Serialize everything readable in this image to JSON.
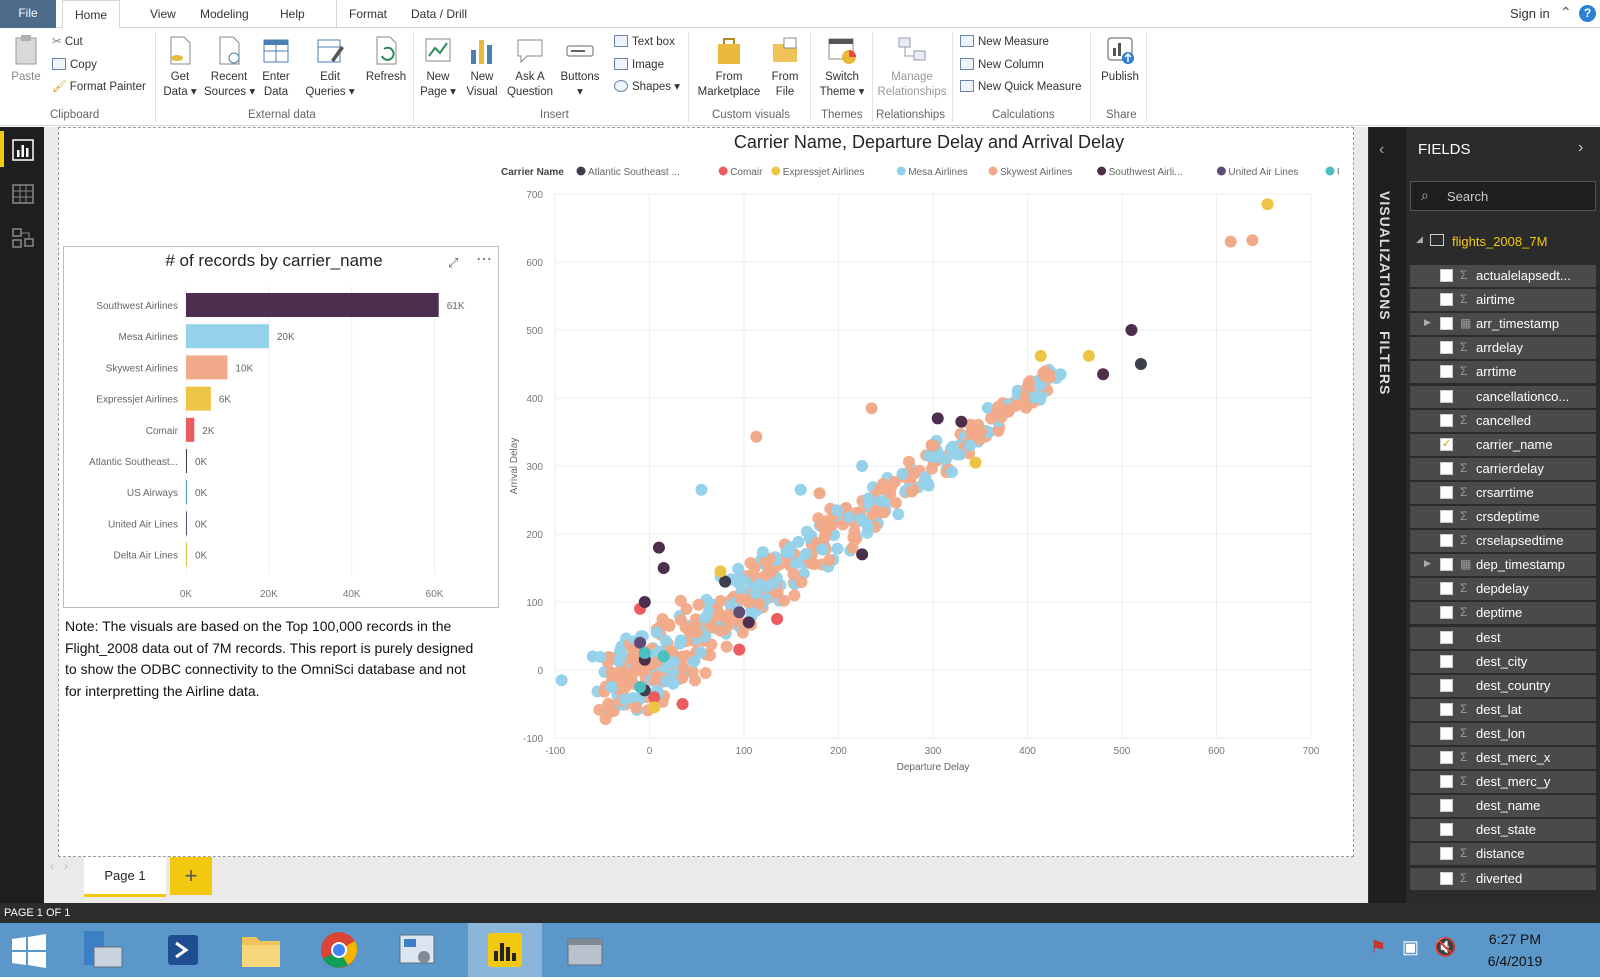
{
  "ribbon_tabs": [
    "File",
    "Home",
    "View",
    "Modeling",
    "Help",
    "Format",
    "Data / Drill"
  ],
  "sign_in": "Sign in",
  "ribbon": {
    "clipboard": {
      "paste": "Paste",
      "cut": "Cut",
      "copy": "Copy",
      "format_painter": "Format Painter",
      "group": "Clipboard"
    },
    "external": {
      "get_data": [
        "Get",
        "Data ▾"
      ],
      "recent": [
        "Recent",
        "Sources ▾"
      ],
      "enter": [
        "Enter",
        "Data"
      ],
      "edit": [
        "Edit",
        "Queries ▾"
      ],
      "refresh": "Refresh",
      "group": "External data"
    },
    "insert": {
      "new_page": [
        "New",
        "Page ▾"
      ],
      "new_visual": [
        "New",
        "Visual"
      ],
      "ask": [
        "Ask A",
        "Question"
      ],
      "buttons": [
        "Buttons",
        "▾"
      ],
      "text_box": "Text box",
      "image": "Image",
      "shapes": "Shapes ▾",
      "group": "Insert"
    },
    "custom": {
      "marketplace": [
        "From",
        "Marketplace"
      ],
      "file": [
        "From",
        "File"
      ],
      "group": "Custom visuals"
    },
    "themes": {
      "switch": [
        "Switch",
        "Theme ▾"
      ],
      "group": "Themes"
    },
    "relationships": {
      "manage": [
        "Manage",
        "Relationships"
      ],
      "group": "Relationships"
    },
    "calculations": {
      "new_measure": "New Measure",
      "new_column": "New Column",
      "new_quick": "New Quick Measure",
      "group": "Calculations"
    },
    "share": {
      "publish": "Publish",
      "group": "Share"
    }
  },
  "bar_chart": {
    "title": "# of records by carrier_name",
    "categories": [
      "Southwest Airlines",
      "Mesa Airlines",
      "Skywest Airlines",
      "Expressjet Airlines",
      "Comair",
      "Atlantic Southeast...",
      "US Airways",
      "United Air Lines",
      "Delta Air Lines"
    ],
    "values": [
      61000,
      20000,
      10000,
      6000,
      2000,
      0,
      0,
      0,
      0
    ],
    "value_labels": [
      "61K",
      "20K",
      "10K",
      "6K",
      "2K",
      "0K",
      "0K",
      "0K",
      "0K"
    ],
    "colors": [
      "#4b2f4c",
      "#94d1ea",
      "#f1aa89",
      "#eec445",
      "#ec5b5d",
      "#3d3f4d",
      "#4b9cc9",
      "#5f4c77",
      "#d6c94b"
    ],
    "x_ticks": [
      "0K",
      "20K",
      "40K",
      "60K"
    ]
  },
  "note": "Note: The visuals are based on the Top 100,000 records in the Flight_2008 data out of 7M records. This report is purely designed to show the ODBC connectivity to the OmniSci database and not for interpretting the Airline data.",
  "chart_data": {
    "type": "scatter",
    "title": "Carrier Name, Departure Delay and Arrival Delay",
    "xlabel": "Departure Delay",
    "ylabel": "Arrival Delay",
    "xlim": [
      -100,
      700
    ],
    "ylim": [
      -100,
      700
    ],
    "x_ticks": [
      -100,
      0,
      100,
      200,
      300,
      400,
      500,
      600,
      700
    ],
    "y_ticks": [
      -100,
      0,
      100,
      200,
      300,
      400,
      500,
      600,
      700
    ],
    "legend_title": "Carrier Name",
    "legend_position": "top",
    "series": [
      {
        "name": "Atlantic Southeast ...",
        "color": "#3d3f4d",
        "points": [
          [
            -5,
            -30
          ],
          [
            80,
            130
          ],
          [
            300,
            330
          ],
          [
            520,
            450
          ]
        ]
      },
      {
        "name": "Comair",
        "color": "#ec5b5d",
        "points": [
          [
            -10,
            90
          ],
          [
            5,
            -40
          ],
          [
            35,
            -50
          ],
          [
            135,
            75
          ],
          [
            95,
            30
          ]
        ]
      },
      {
        "name": "Expressjet Airlines",
        "color": "#eec445",
        "points": [
          [
            654,
            685
          ],
          [
            414,
            462
          ],
          [
            465,
            462
          ],
          [
            345,
            305
          ],
          [
            5,
            -55
          ],
          [
            75,
            145
          ]
        ]
      },
      {
        "name": "Mesa Airlines",
        "color": "#94d1ea",
        "points": [
          [
            -93,
            -15
          ],
          [
            -40,
            -25
          ],
          [
            55,
            265
          ],
          [
            160,
            265
          ],
          [
            435,
            435
          ],
          [
            408,
            400
          ],
          [
            225,
            300
          ],
          [
            -60,
            20
          ],
          [
            25,
            -20
          ]
        ]
      },
      {
        "name": "Skywest Airlines",
        "color": "#f1aa89",
        "points": [
          [
            615,
            630
          ],
          [
            638,
            632
          ],
          [
            113,
            343
          ],
          [
            235,
            385
          ],
          [
            180,
            260
          ],
          [
            300,
            330
          ],
          [
            380,
            380
          ]
        ]
      },
      {
        "name": "Southwest Airli...",
        "color": "#4b2f4c",
        "points": [
          [
            510,
            500
          ],
          [
            480,
            435
          ],
          [
            330,
            365
          ],
          [
            305,
            370
          ],
          [
            10,
            180
          ],
          [
            15,
            150
          ],
          [
            -5,
            100
          ],
          [
            -5,
            15
          ],
          [
            105,
            70
          ],
          [
            225,
            170
          ]
        ]
      },
      {
        "name": "United Air Lines",
        "color": "#5f4c77",
        "points": [
          [
            -10,
            40
          ],
          [
            95,
            85
          ]
        ]
      },
      {
        "name": "US Airways",
        "color": "#4bbfbf",
        "points": [
          [
            -10,
            -25
          ],
          [
            15,
            20
          ],
          [
            -5,
            25
          ]
        ]
      }
    ],
    "bulk_band": {
      "from": [
        -30,
        -40
      ],
      "to": [
        430,
        420
      ],
      "colors": [
        "#f1aa89",
        "#94d1ea"
      ]
    }
  },
  "page_tab": "Page 1",
  "add_page": "+",
  "side_labels": {
    "viz": "VISUALIZATIONS",
    "filters": "FILTERS"
  },
  "fields": {
    "header": "FIELDS",
    "search_placeholder": "Search",
    "table": "flights_2008_7M",
    "items": [
      {
        "name": "actualelapsedt...",
        "sigma": true,
        "checked": false
      },
      {
        "name": "airtime",
        "sigma": true,
        "checked": false
      },
      {
        "name": "arr_timestamp",
        "sigma": false,
        "checked": false,
        "table": true
      },
      {
        "name": "arrdelay",
        "sigma": true,
        "checked": false
      },
      {
        "name": "arrtime",
        "sigma": true,
        "checked": false
      },
      {
        "name": "cancellationco...",
        "sigma": false,
        "checked": false
      },
      {
        "name": "cancelled",
        "sigma": true,
        "checked": false
      },
      {
        "name": "carrier_name",
        "sigma": false,
        "checked": true
      },
      {
        "name": "carrierdelay",
        "sigma": true,
        "checked": false
      },
      {
        "name": "crsarrtime",
        "sigma": true,
        "checked": false
      },
      {
        "name": "crsdeptime",
        "sigma": true,
        "checked": false
      },
      {
        "name": "crselapsedtime",
        "sigma": true,
        "checked": false
      },
      {
        "name": "dep_timestamp",
        "sigma": false,
        "checked": false,
        "table": true
      },
      {
        "name": "depdelay",
        "sigma": true,
        "checked": false
      },
      {
        "name": "deptime",
        "sigma": true,
        "checked": false
      },
      {
        "name": "dest",
        "sigma": false,
        "checked": false
      },
      {
        "name": "dest_city",
        "sigma": false,
        "checked": false
      },
      {
        "name": "dest_country",
        "sigma": false,
        "checked": false
      },
      {
        "name": "dest_lat",
        "sigma": true,
        "checked": false
      },
      {
        "name": "dest_lon",
        "sigma": true,
        "checked": false
      },
      {
        "name": "dest_merc_x",
        "sigma": true,
        "checked": false
      },
      {
        "name": "dest_merc_y",
        "sigma": true,
        "checked": false
      },
      {
        "name": "dest_name",
        "sigma": false,
        "checked": false
      },
      {
        "name": "dest_state",
        "sigma": false,
        "checked": false
      },
      {
        "name": "distance",
        "sigma": true,
        "checked": false
      },
      {
        "name": "diverted",
        "sigma": true,
        "checked": false
      }
    ]
  },
  "status": "PAGE 1 OF 1",
  "clock": {
    "time": "6:27 PM",
    "date": "6/4/2019"
  }
}
